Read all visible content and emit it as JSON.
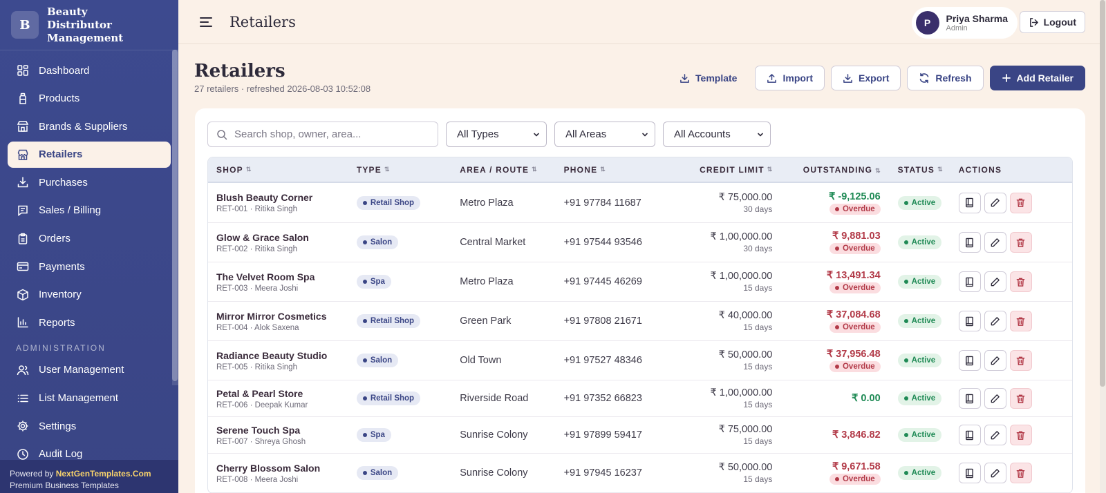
{
  "brand": {
    "logo_letter": "B",
    "name": "Beauty Distributor Management"
  },
  "nav": {
    "items": [
      {
        "label": "Dashboard",
        "icon": "dashboard-icon"
      },
      {
        "label": "Products",
        "icon": "bottle-icon"
      },
      {
        "label": "Brands & Suppliers",
        "icon": "store-icon"
      },
      {
        "label": "Retailers",
        "icon": "building-icon",
        "active": true
      },
      {
        "label": "Purchases",
        "icon": "download-icon"
      },
      {
        "label": "Sales / Billing",
        "icon": "receipt-icon"
      },
      {
        "label": "Orders",
        "icon": "clipboard-icon"
      },
      {
        "label": "Payments",
        "icon": "card-icon"
      },
      {
        "label": "Inventory",
        "icon": "box-icon"
      },
      {
        "label": "Reports",
        "icon": "chart-icon"
      }
    ],
    "admin_section": "ADMINISTRATION",
    "admin_items": [
      {
        "label": "User Management",
        "icon": "users-icon"
      },
      {
        "label": "List Management",
        "icon": "list-icon"
      },
      {
        "label": "Settings",
        "icon": "gear-icon"
      },
      {
        "label": "Audit Log",
        "icon": "clock-icon"
      }
    ]
  },
  "footer": {
    "powered_prefix": "Powered by ",
    "powered_brand": "NextGenTemplates.Com",
    "tagline": "Premium Business Templates"
  },
  "topbar": {
    "title": "Retailers",
    "user_initial": "P",
    "user_name": "Priya Sharma",
    "user_role": "Admin",
    "logout_label": "Logout"
  },
  "page": {
    "title": "Retailers",
    "subtitle": "27 retailers · refreshed 2026-08-03 10:52:08",
    "actions": {
      "template": "Template",
      "import": "Import",
      "export": "Export",
      "refresh": "Refresh",
      "add": "Add Retailer"
    }
  },
  "filters": {
    "search_placeholder": "Search shop, owner, area...",
    "type": "All Types",
    "area": "All Areas",
    "account": "All Accounts"
  },
  "table": {
    "headers": {
      "shop": "SHOP",
      "type": "TYPE",
      "area": "AREA / ROUTE",
      "phone": "PHONE",
      "credit": "CREDIT LIMIT",
      "outstanding": "OUTSTANDING",
      "status": "STATUS",
      "actions": "ACTIONS"
    },
    "overdue_label": "Overdue",
    "rows": [
      {
        "shop": "Blush Beauty Corner",
        "sub": "RET-001 · Ritika Singh",
        "type": "Retail Shop",
        "area": "Metro Plaza",
        "phone": "+91 97784 11687",
        "credit": "₹ 75,000.00",
        "days": "30 days",
        "outstanding": "₹ -9,125.06",
        "out_kind": "neg",
        "overdue": true,
        "status": "Active"
      },
      {
        "shop": "Glow & Grace Salon",
        "sub": "RET-002 · Ritika Singh",
        "type": "Salon",
        "area": "Central Market",
        "phone": "+91 97544 93546",
        "credit": "₹ 1,00,000.00",
        "days": "30 days",
        "outstanding": "₹ 9,881.03",
        "out_kind": "due",
        "overdue": true,
        "status": "Active"
      },
      {
        "shop": "The Velvet Room Spa",
        "sub": "RET-003 · Meera Joshi",
        "type": "Spa",
        "area": "Metro Plaza",
        "phone": "+91 97445 46269",
        "credit": "₹ 1,00,000.00",
        "days": "15 days",
        "outstanding": "₹ 13,491.34",
        "out_kind": "due",
        "overdue": true,
        "status": "Active"
      },
      {
        "shop": "Mirror Mirror Cosmetics",
        "sub": "RET-004 · Alok Saxena",
        "type": "Retail Shop",
        "area": "Green Park",
        "phone": "+91 97808 21671",
        "credit": "₹ 40,000.00",
        "days": "15 days",
        "outstanding": "₹ 37,084.68",
        "out_kind": "due",
        "overdue": true,
        "status": "Active"
      },
      {
        "shop": "Radiance Beauty Studio",
        "sub": "RET-005 · Ritika Singh",
        "type": "Salon",
        "area": "Old Town",
        "phone": "+91 97527 48346",
        "credit": "₹ 50,000.00",
        "days": "15 days",
        "outstanding": "₹ 37,956.48",
        "out_kind": "due",
        "overdue": true,
        "status": "Active"
      },
      {
        "shop": "Petal & Pearl Store",
        "sub": "RET-006 · Deepak Kumar",
        "type": "Retail Shop",
        "area": "Riverside Road",
        "phone": "+91 97352 66823",
        "credit": "₹ 1,00,000.00",
        "days": "15 days",
        "outstanding": "₹ 0.00",
        "out_kind": "zero",
        "overdue": false,
        "status": "Active"
      },
      {
        "shop": "Serene Touch Spa",
        "sub": "RET-007 · Shreya Ghosh",
        "type": "Spa",
        "area": "Sunrise Colony",
        "phone": "+91 97899 59417",
        "credit": "₹ 75,000.00",
        "days": "15 days",
        "outstanding": "₹ 3,846.82",
        "out_kind": "due",
        "overdue": false,
        "status": "Active"
      },
      {
        "shop": "Cherry Blossom Salon",
        "sub": "RET-008 · Meera Joshi",
        "type": "Salon",
        "area": "Sunrise Colony",
        "phone": "+91 97945 16237",
        "credit": "₹ 50,000.00",
        "days": "15 days",
        "outstanding": "₹ 9,671.58",
        "out_kind": "due",
        "overdue": true,
        "status": "Active"
      }
    ]
  },
  "colors": {
    "primary": "#3a4585",
    "background": "#fbf1e8",
    "success": "#1f8a55",
    "danger": "#b23a48"
  }
}
